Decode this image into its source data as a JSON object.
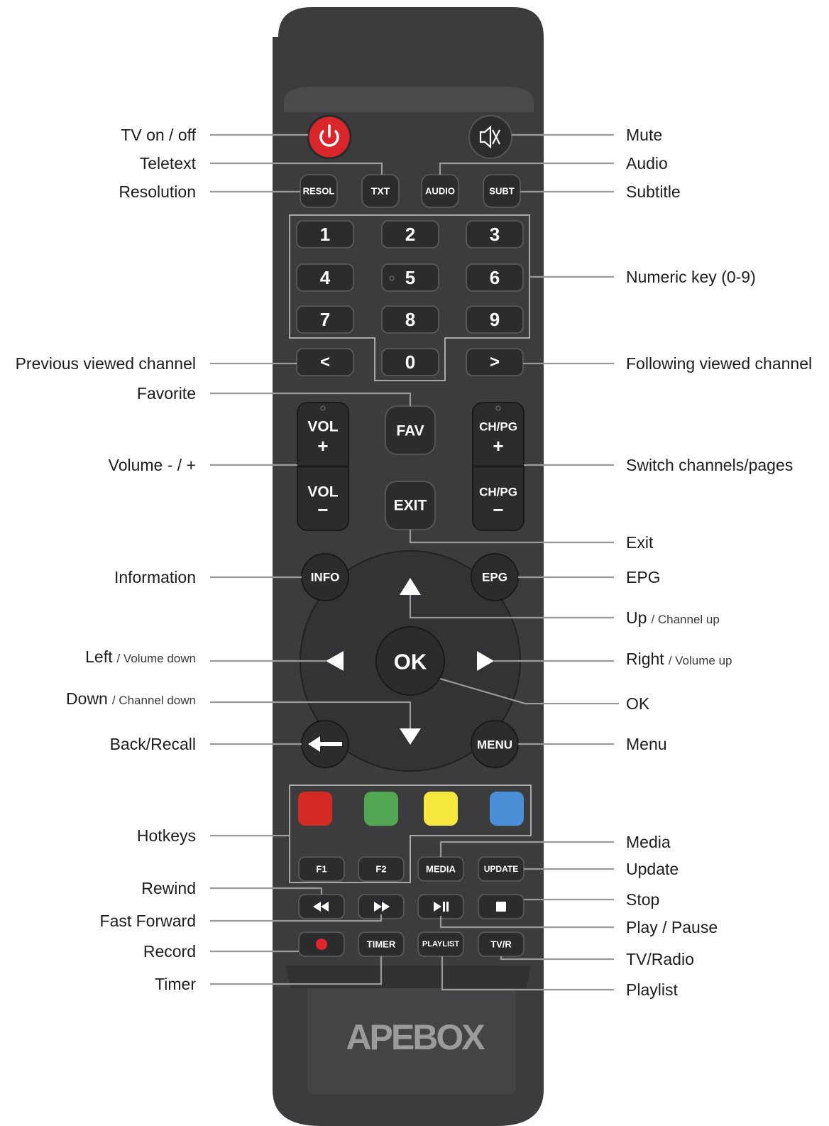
{
  "brand": "APEBOX",
  "colors": {
    "body": "#3c3c3e",
    "body_dark": "#2f2f31",
    "key": "#2c2c2e",
    "power": "#d8262a",
    "hotkey_red": "#d32a24",
    "hotkey_green": "#54a752",
    "hotkey_yellow": "#f6e83e",
    "hotkey_blue": "#4b8fd9",
    "record": "#e3262b"
  },
  "keys": {
    "resol": "RESOL",
    "txt": "TXT",
    "audio": "AUDIO",
    "subt": "SUBT",
    "digits": [
      "1",
      "2",
      "3",
      "4",
      "5",
      "6",
      "7",
      "8",
      "9",
      "0"
    ],
    "prev": "<",
    "next": ">",
    "vol": "VOL",
    "fav": "FAV",
    "chpg": "CH/PG",
    "plus": "+",
    "minus": "−",
    "exit": "EXIT",
    "info": "INFO",
    "epg": "EPG",
    "ok": "OK",
    "menu": "MENU",
    "f1": "F1",
    "f2": "F2",
    "media": "MEDIA",
    "update": "UPDATE",
    "timer": "TIMER",
    "playlist": "PLAYLIST",
    "tvr": "TV/R"
  },
  "icons": {
    "power": "power-icon",
    "mute": "mute-icon",
    "rewind": "rewind-icon",
    "fast_forward": "fast-forward-icon",
    "play_pause": "play-pause-icon",
    "stop": "stop-icon",
    "record": "record-icon",
    "back": "back-arrow-icon",
    "up": "up-triangle-icon",
    "down": "down-triangle-icon",
    "left": "left-triangle-icon",
    "right": "right-triangle-icon"
  },
  "labels_left": {
    "tv_on_off": "TV on / off",
    "teletext": "Teletext",
    "resolution": "Resolution",
    "previous_channel": "Previous viewed channel",
    "favorite": "Favorite",
    "volume": "Volume - / +",
    "information": "Information",
    "left_main": "Left",
    "left_sub": "/ Volume down",
    "down_main": "Down",
    "down_sub": "/ Channel down",
    "back_recall": "Back/Recall",
    "hotkeys": "Hotkeys",
    "rewind": "Rewind",
    "fast_forward": "Fast Forward",
    "record": "Record",
    "timer": "Timer"
  },
  "labels_right": {
    "mute": "Mute",
    "audio": "Audio",
    "subtitle": "Subtitle",
    "numeric": "Numeric key (0-9)",
    "following_channel": "Following viewed channel",
    "switch_channels": "Switch channels/pages",
    "exit": "Exit",
    "epg": "EPG",
    "up_main": "Up",
    "up_sub": "/ Channel up",
    "right_main": "Right",
    "right_sub": "/ Volume up",
    "ok": "OK",
    "menu": "Menu",
    "media": "Media",
    "update": "Update",
    "stop": "Stop",
    "play_pause": "Play / Pause",
    "tv_radio": "TV/Radio",
    "playlist": "Playlist"
  }
}
